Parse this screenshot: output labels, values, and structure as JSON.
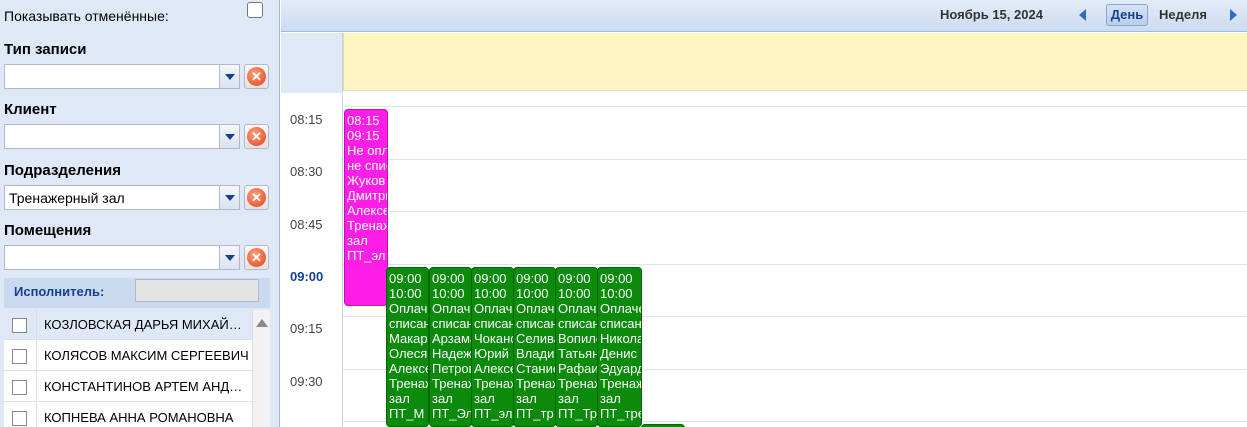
{
  "filters": {
    "show_cancelled_label": "Показывать отменённые:",
    "record_type_label": "Тип записи",
    "record_type_value": "",
    "client_label": "Клиент",
    "client_value": "",
    "division_label": "Подразделения",
    "division_value": "Тренажерный зал",
    "rooms_label": "Помещения",
    "rooms_value": "",
    "clear_glyph": "✕"
  },
  "executor": {
    "label": "Исполнитель:",
    "items": [
      "КОЗЛОВСКАЯ ДАРЬЯ МИХАЙЛОВНА",
      "КОЛЯСОВ МАКСИМ СЕРГЕЕВИЧ",
      "КОНСТАНТИНОВ АРТЕМ АНДРЕЕВИЧ",
      "КОПНЕВА АННА РОМАНОВНА"
    ]
  },
  "toolbar": {
    "date": "Ноябрь 15, 2024",
    "day_label": "День",
    "week_label": "Неделя"
  },
  "times": [
    "08:15",
    "08:30",
    "08:45",
    "09:00",
    "09:15",
    "09:30"
  ],
  "events": {
    "pink": [
      "08:15",
      "09:15",
      "Не оплачено",
      "не списано",
      "Жуков",
      "Дмитрий",
      "Алексеевич",
      "Тренажерный",
      "зал",
      "ПТ_эл"
    ],
    "green": [
      [
        "09:00",
        "10:00",
        "Оплачено",
        "списано",
        "Макаров",
        "Олеся",
        "Алексеевна",
        "Тренажерный",
        "зал",
        "ПТ_М"
      ],
      [
        "09:00",
        "10:00",
        "Оплачено",
        "списано",
        "Арзамасов",
        "Надежда",
        "Петровна",
        "Тренажерный",
        "зал",
        "ПТ_Эл"
      ],
      [
        "09:00",
        "10:00",
        "Оплачено",
        "списано",
        "Чоканов",
        "Юрий",
        "Алексеевич",
        "Тренажерный",
        "зал",
        "ПТ_эл"
      ],
      [
        "09:00",
        "10:00",
        "Оплачено",
        "списано",
        "Селиванов",
        "Владимир",
        "Станиславович",
        "Тренажерный",
        "зал",
        "ПТ_тр"
      ],
      [
        "09:00",
        "10:00",
        "Оплачено",
        "списано",
        "Вопилова",
        "Татьяна",
        "Рафаиловна",
        "Тренажерный",
        "зал",
        "ПТ_Тр"
      ],
      [
        "09:00",
        "10:00",
        "Оплачено",
        "списано",
        "Николаев",
        "Денис",
        "Эдуардович",
        "Тренажерный",
        "зал",
        "ПТ_тре"
      ]
    ]
  },
  "colors": {
    "pink_event": "#ff1ee8",
    "green_event": "#0b8a0b",
    "allday": "#fff5c0",
    "panel": "#dfe8f6"
  }
}
